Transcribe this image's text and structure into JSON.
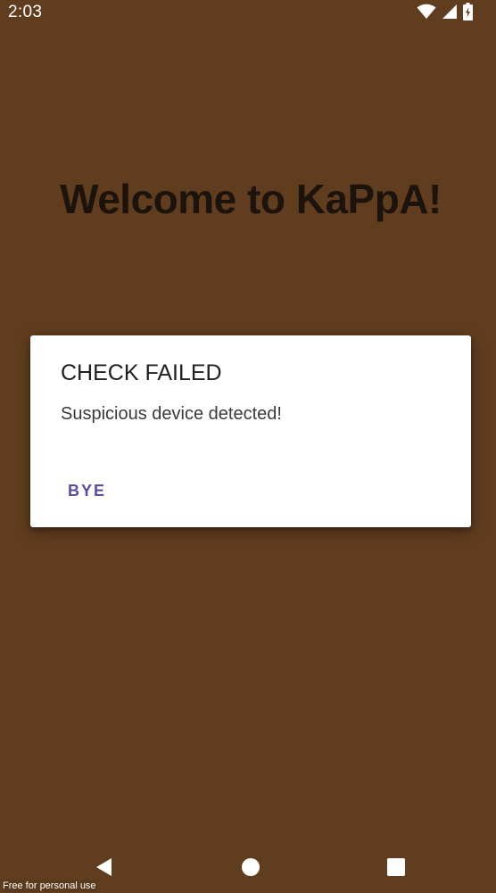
{
  "status_bar": {
    "time": "2:03",
    "icons": [
      "wifi-icon",
      "cell-signal-icon",
      "battery-charging-icon"
    ]
  },
  "app": {
    "title": "Welcome to KaPpA!",
    "background_color": "#613d1f"
  },
  "dialog": {
    "title": "CHECK FAILED",
    "message": "Suspicious device detected!",
    "button_label": "BYE",
    "button_color": "#5c4b9e"
  },
  "nav_bar": {
    "icons": [
      "back-icon",
      "home-icon",
      "recents-icon"
    ]
  },
  "watermark": "Free for personal use"
}
